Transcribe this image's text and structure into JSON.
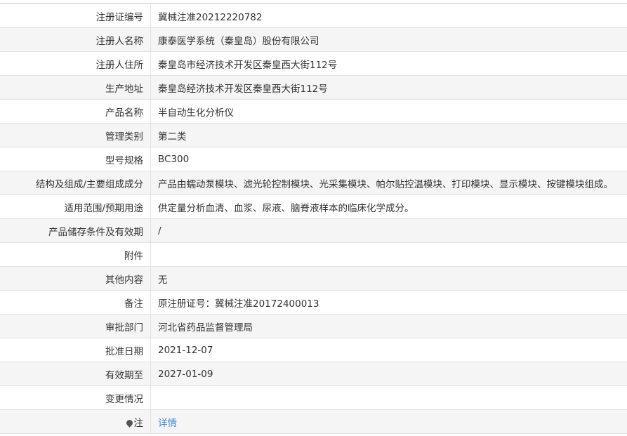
{
  "rows": [
    {
      "label": "注册证编号",
      "value": "冀械注准20212220782"
    },
    {
      "label": "注册人名称",
      "value": "康泰医学系统（秦皇岛）股份有限公司"
    },
    {
      "label": "注册人住所",
      "value": "秦皇岛市经济技术开发区秦皇西大街112号"
    },
    {
      "label": "生产地址",
      "value": "秦皇岛经济技术开发区秦皇西大街112号"
    },
    {
      "label": "产品名称",
      "value": "半自动生化分析仪"
    },
    {
      "label": "管理类别",
      "value": "第二类"
    },
    {
      "label": "型号规格",
      "value": "BC300"
    },
    {
      "label": "结构及组成/主要组成成分",
      "value": "产品由蠕动泵模块、滤光轮控制模块、光采集模块、帕尔贴控温模块、打印模块、显示模块、按键模块组成。"
    },
    {
      "label": "适用范围/预期用途",
      "value": "供定量分析血清、血浆、尿液、脑脊液样本的临床化学成分。"
    },
    {
      "label": "产品储存条件及有效期",
      "value": "/"
    },
    {
      "label": "附件",
      "value": ""
    },
    {
      "label": "其他内容",
      "value": "无"
    },
    {
      "label": "备注",
      "value": "原注册证号：冀械注准20172400013"
    },
    {
      "label": "审批部门",
      "value": "河北省药品监督管理局"
    },
    {
      "label": "批准日期",
      "value": "2021-12-07"
    },
    {
      "label": "有效期至",
      "value": "2027-01-09"
    },
    {
      "label": "变更情况",
      "value": ""
    }
  ],
  "note_row": {
    "icon": "pin-icon",
    "label": "注",
    "link_text": "详情"
  }
}
